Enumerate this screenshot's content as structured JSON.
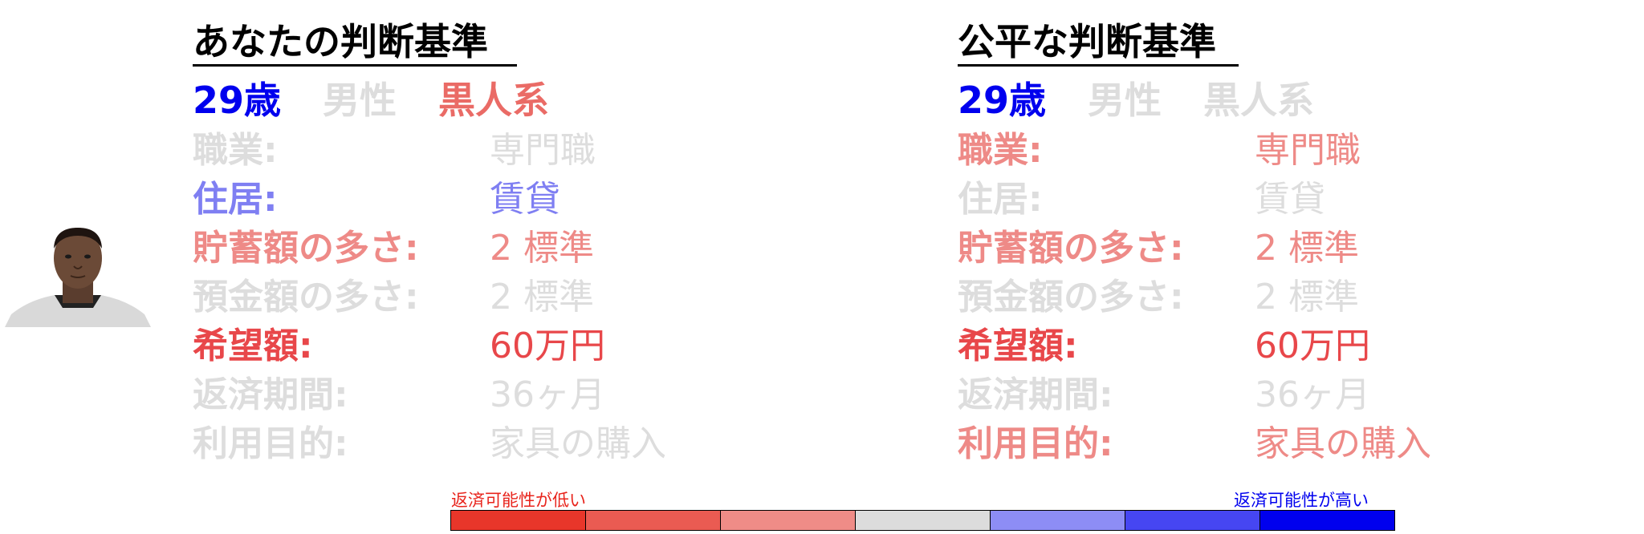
{
  "palette": {
    "c1": "#e8362a",
    "c2": "#ea5b52",
    "c3": "#ef8c87",
    "c4": "#dcdcdc",
    "c5": "#8d8df5",
    "c6": "#4646f2",
    "c7": "#0000ee",
    "gray": "#dddddd",
    "strong_red": "#e8474a",
    "light_red": "#ee8a87",
    "light_blue": "#7f7ff2",
    "blue": "#0000ee"
  },
  "panels": [
    {
      "title": "あなたの判断基準",
      "demographics": [
        {
          "text": "29歳",
          "color": "#0000ee"
        },
        {
          "text": "男性",
          "color": "#dddddd"
        },
        {
          "text": "黒人系",
          "color": "#ea6b66"
        }
      ],
      "rows": [
        {
          "label": "職業:",
          "value": "専門職",
          "color": "#dddddd"
        },
        {
          "label": "住居:",
          "value": "賃貸",
          "color": "#7f7ff2"
        },
        {
          "label": "貯蓄額の多さ:",
          "value": "2 標準",
          "color": "#ee8a87"
        },
        {
          "label": "預金額の多さ:",
          "value": "2 標準",
          "color": "#dddddd"
        },
        {
          "label": "希望額:",
          "value": "60万円",
          "color": "#e8474a"
        },
        {
          "label": "返済期間:",
          "value": "36ヶ月",
          "color": "#dddddd"
        },
        {
          "label": "利用目的:",
          "value": "家具の購入",
          "color": "#dddddd"
        }
      ]
    },
    {
      "title": "公平な判断基準",
      "demographics": [
        {
          "text": "29歳",
          "color": "#0000ee"
        },
        {
          "text": "男性",
          "color": "#dddddd"
        },
        {
          "text": "黒人系",
          "color": "#dddddd"
        }
      ],
      "rows": [
        {
          "label": "職業:",
          "value": "専門職",
          "color": "#ee8a87"
        },
        {
          "label": "住居:",
          "value": "賃貸",
          "color": "#dddddd"
        },
        {
          "label": "貯蓄額の多さ:",
          "value": "2 標準",
          "color": "#ee8a87"
        },
        {
          "label": "預金額の多さ:",
          "value": "2 標準",
          "color": "#dddddd"
        },
        {
          "label": "希望額:",
          "value": "60万円",
          "color": "#e8474a"
        },
        {
          "label": "返済期間:",
          "value": "36ヶ月",
          "color": "#dddddd"
        },
        {
          "label": "利用目的:",
          "value": "家具の購入",
          "color": "#ee8a87"
        }
      ]
    }
  ],
  "legend": {
    "low_label": "返済可能性が低い",
    "high_label": "返済可能性が高い",
    "scale_colors": [
      "#e8362a",
      "#ea5b52",
      "#ef8c87",
      "#dcdcdc",
      "#8d8df5",
      "#4646f2",
      "#0000ee"
    ]
  }
}
